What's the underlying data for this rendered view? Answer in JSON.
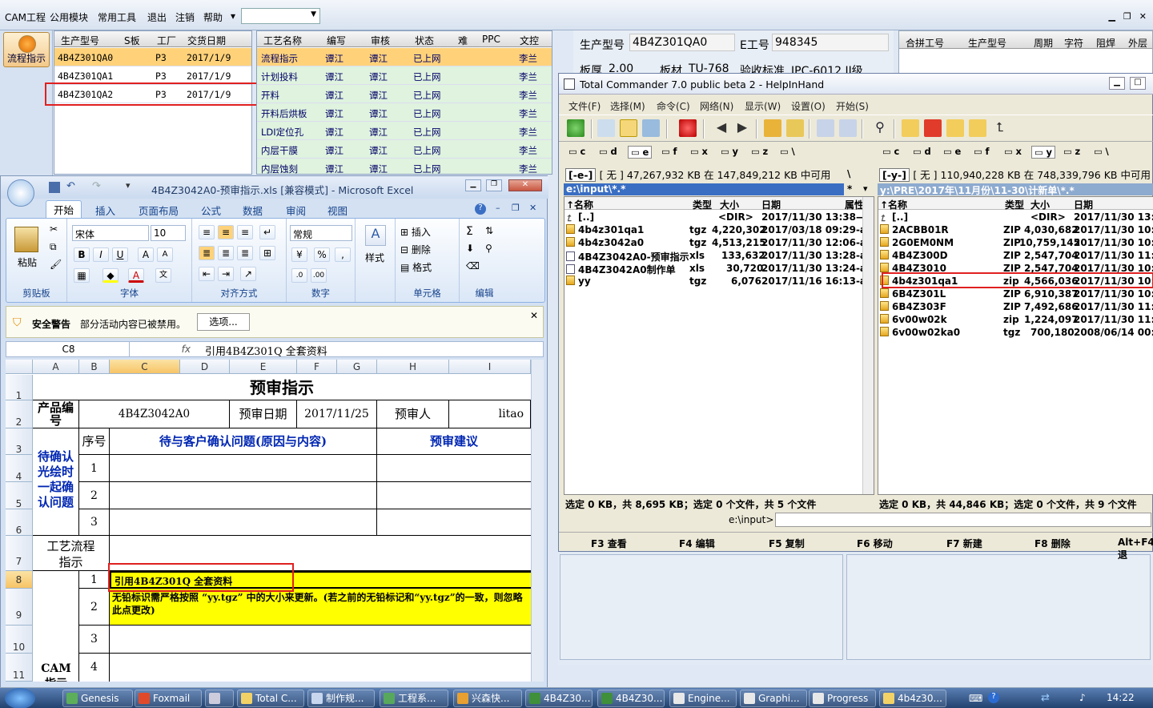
{
  "cam": {
    "menu": [
      "CAM工程",
      "公用模块",
      "常用工具",
      "退出",
      "注销",
      "帮助"
    ],
    "menu_more": "▾",
    "flow_button": "流程指示",
    "order_table": {
      "headers": [
        "生产型号",
        "S板",
        "工厂",
        "交货日期"
      ],
      "rows": [
        [
          "4B4Z301QA0",
          "",
          "P3",
          "2017/1/9"
        ],
        [
          "4B4Z301QA1",
          "",
          "P3",
          "2017/1/9"
        ],
        [
          "4B4Z301QA2",
          "",
          "P3",
          "2017/1/9"
        ]
      ]
    },
    "flow_table": {
      "headers": [
        "工艺名称",
        "编写",
        "审核",
        "状态",
        "难",
        "PPC",
        "文控"
      ],
      "rows": [
        [
          "流程指示",
          "谭江",
          "谭江",
          "已上网",
          "",
          "",
          "李兰"
        ],
        [
          "计划投料",
          "谭江",
          "谭江",
          "已上网",
          "",
          "",
          "李兰"
        ],
        [
          "开料",
          "谭江",
          "谭江",
          "已上网",
          "",
          "",
          "李兰"
        ],
        [
          "开料后烘板",
          "谭江",
          "谭江",
          "已上网",
          "",
          "",
          "李兰"
        ],
        [
          "LDI定位孔",
          "谭江",
          "谭江",
          "已上网",
          "",
          "",
          "李兰"
        ],
        [
          "内层干膜",
          "谭江",
          "谭江",
          "已上网",
          "",
          "",
          "李兰"
        ],
        [
          "内层蚀刻",
          "谭江",
          "谭江",
          "已上网",
          "",
          "",
          "李兰"
        ]
      ]
    },
    "info": {
      "model_label": "生产型号",
      "model_value": "4B4Z301QA0",
      "eno_label": "E工号",
      "eno_value": "948345",
      "thick_label": "板厚",
      "thick_value": "2.00",
      "mat_label": "板材",
      "mat_value": "TU-768",
      "std_label": "验收标准",
      "std_value": "IPC-6012 II级"
    },
    "merge_headers": [
      "合拼工号",
      "生产型号",
      "周期",
      "字符",
      "阻焊",
      "外层"
    ]
  },
  "tc": {
    "title": "Total Commander 7.0 public beta 2 - HelpInHand",
    "menu": [
      "文件(F)",
      "选择(M)",
      "命令(C)",
      "网络(N)",
      "显示(W)",
      "设置(O)",
      "开始(S)"
    ],
    "drives_left": [
      "c",
      "d",
      "e",
      "f",
      "x",
      "y",
      "z",
      "\\"
    ],
    "drives_right": [
      "c",
      "d",
      "e",
      "f",
      "x",
      "y",
      "z",
      "\\"
    ],
    "left": {
      "drive": "[-e-]",
      "free": "[ 无 ]  47,267,932 KB 在 147,849,212 KB 中可用",
      "path": "e:\\input\\*.*",
      "headers": [
        "↑名称",
        "类型",
        "大小",
        "日期",
        "属性"
      ],
      "rows": [
        {
          "name": "[..]",
          "ext": "",
          "size": "<DIR>",
          "date": "2017/11/30 13:38—",
          "icon": "up"
        },
        {
          "name": "4b4z301qa1",
          "ext": "tgz",
          "size": "4,220,302",
          "date": "2017/03/18 09:29-a–",
          "icon": "arc"
        },
        {
          "name": "4b4z3042a0",
          "ext": "tgz",
          "size": "4,513,215",
          "date": "2017/11/30 12:06-a–",
          "icon": "arc"
        },
        {
          "name": "4B4Z3042A0-预审指示",
          "ext": "xls",
          "size": "133,632",
          "date": "2017/11/30 13:28-a–",
          "icon": "doc"
        },
        {
          "name": "4B4Z3042A0制作单",
          "ext": "xls",
          "size": "30,720",
          "date": "2017/11/30 13:24-a–",
          "icon": "doc"
        },
        {
          "name": "yy",
          "ext": "tgz",
          "size": "6,076",
          "date": "2017/11/16 16:13-a–",
          "icon": "arc"
        }
      ],
      "status": "选定 0 KB，共 8,695 KB；选定 0 个文件，共 5 个文件"
    },
    "right": {
      "drive": "[-y-]",
      "free": "[ 无 ]  110,940,228 KB 在 748,339,796 KB 中可用",
      "path": "y:\\PRE\\2017年\\11月份\\11-30\\计新单\\*.*",
      "headers": [
        "↑名称",
        "类型",
        "大小",
        "日期"
      ],
      "rows": [
        {
          "name": "[..]",
          "ext": "",
          "size": "<DIR>",
          "date": "2017/11/30 13:2",
          "icon": "up"
        },
        {
          "name": "2ACBB01R",
          "ext": "ZIP",
          "size": "4,030,682",
          "date": "2017/11/30 10:1",
          "icon": "arc"
        },
        {
          "name": "2G0EM0NM",
          "ext": "ZIP",
          "size": "10,759,145",
          "date": "2017/11/30 10:0",
          "icon": "arc"
        },
        {
          "name": "4B4Z300D",
          "ext": "ZIP",
          "size": "2,547,704",
          "date": "2017/11/30 11:2",
          "icon": "arc"
        },
        {
          "name": "4B4Z3010",
          "ext": "ZIP",
          "size": "2,547,704",
          "date": "2017/11/30 10:1",
          "icon": "arc"
        },
        {
          "name": "4b4z301qa1",
          "ext": "zip",
          "size": "4,566,036",
          "date": "2017/11/30 10:0",
          "icon": "arc"
        },
        {
          "name": "6B4Z301L",
          "ext": "ZIP",
          "size": "6,910,387",
          "date": "2017/11/30 10:1",
          "icon": "arc"
        },
        {
          "name": "6B4Z303F",
          "ext": "ZIP",
          "size": "7,492,686",
          "date": "2017/11/30 11:4",
          "icon": "arc"
        },
        {
          "name": "6v00w02k",
          "ext": "zip",
          "size": "1,224,097",
          "date": "2017/11/30 11:2",
          "icon": "arc"
        },
        {
          "name": "6v00w02ka0",
          "ext": "tgz",
          "size": "700,180",
          "date": "2008/06/14 00:0",
          "icon": "arc"
        }
      ],
      "status": "选定 0 KB，共 44,846 KB；选定 0 个文件，共 9 个文件"
    },
    "cmd_path": "e:\\input>",
    "fkeys": [
      "F3 查看",
      "F4 编辑",
      "F5 复制",
      "F6 移动",
      "F7 新建",
      "F8 删除",
      "Alt+F4 退"
    ]
  },
  "excel": {
    "title": "4B4Z3042A0-预审指示.xls  [兼容模式] - Microsoft Excel",
    "tabs": [
      "开始",
      "插入",
      "页面布局",
      "公式",
      "数据",
      "审阅",
      "视图"
    ],
    "groups": [
      "剪贴板",
      "字体",
      "对齐方式",
      "数字",
      "样式",
      "单元格",
      "编辑"
    ],
    "paste": "粘贴",
    "font_name": "宋体",
    "font_size": "10",
    "number_format": "常规",
    "style_label": "样式",
    "cells_btns": [
      "插入",
      "删除",
      "格式"
    ],
    "security_title": "安全警告",
    "security_msg": "部分活动内容已被禁用。",
    "security_btn": "选项...",
    "name_box": "C8",
    "formula": "引用4B4Z301Q 全套资料",
    "fx": "fx",
    "cols": [
      "A",
      "B",
      "C",
      "D",
      "E",
      "F",
      "G",
      "H",
      "I"
    ],
    "rows": [
      "1",
      "2",
      "3",
      "4",
      "5",
      "6",
      "7",
      "8",
      "9",
      "10",
      "11"
    ],
    "sheet": {
      "title": "预审指示",
      "product_label": "产品编号",
      "product_value": "4B4Z3042A0",
      "date_label": "预审日期",
      "date_value": "2017/11/25",
      "person_label": "预审人",
      "person_value": "litao",
      "seq_label": "序号",
      "issue_label": "待与客户确认问题(原因与内容)",
      "advice_label": "预审建议",
      "confirm_label": "待确认光绘时一起确认问题",
      "seq1": "1",
      "seq2": "2",
      "seq3": "3",
      "process_label": "工艺流程指示",
      "s1": "1",
      "s2": "2",
      "s3": "3",
      "s4": "4",
      "line1": "引用4B4Z301Q 全套资料",
      "line2": "无铅标识需严格按照 “yy.tgz” 中的大小来更新。(若之前的无铅标记和“yy.tgz”的一致，则忽略此点更改)",
      "cam_label": "CAM指示"
    }
  },
  "taskbar": {
    "items": [
      "Genesis",
      "Foxmail",
      "",
      "Total C...",
      "制作规...",
      "工程系...",
      "兴森快...",
      "4B4Z30...",
      "4B4Z30...",
      "Engine...",
      "Graphi...",
      "Progress",
      "4b4z30..."
    ],
    "clock": "14:22"
  }
}
